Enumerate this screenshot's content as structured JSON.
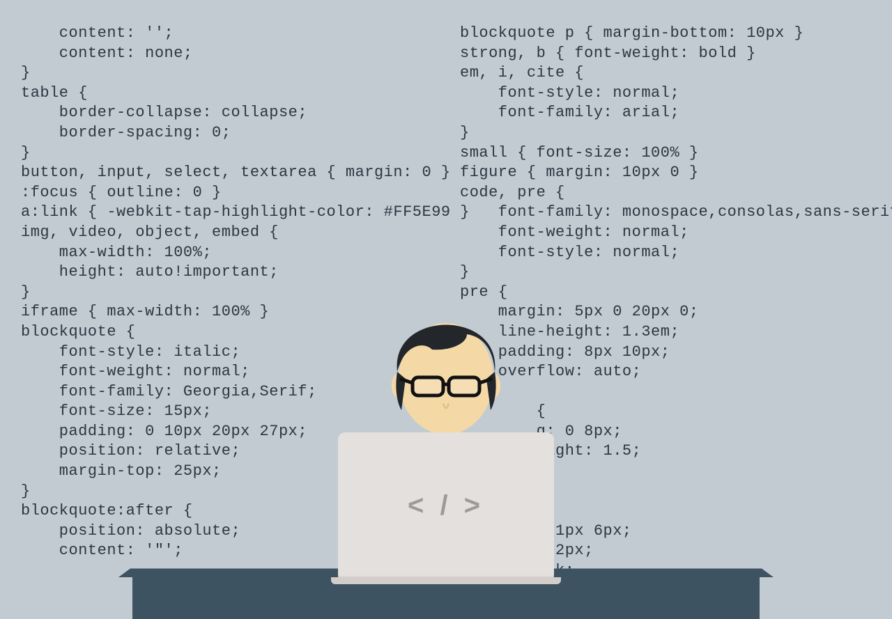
{
  "code_left": [
    "    content: '';",
    "    content: none;",
    "}",
    "table {",
    "    border-collapse: collapse;",
    "    border-spacing: 0;",
    "}",
    "button, input, select, textarea { margin: 0 }",
    ":focus { outline: 0 }",
    "a:link { -webkit-tap-highlight-color: #FF5E99 }",
    "img, video, object, embed {",
    "    max-width: 100%;",
    "    height: auto!important;",
    "}",
    "iframe { max-width: 100% }",
    "blockquote {",
    "    font-style: italic;",
    "    font-weight: normal;",
    "    font-family: Georgia,Serif;",
    "    font-size: 15px;",
    "    padding: 0 10px 20px 27px;",
    "    position: relative;",
    "    margin-top: 25px;",
    "}",
    "blockquote:after {",
    "    position: absolute;",
    "    content: '\"';"
  ],
  "code_right": [
    "blockquote p { margin-bottom: 10px }",
    "strong, b { font-weight: bold }",
    "em, i, cite {",
    "    font-style: normal;",
    "    font-family: arial;",
    "}",
    "small { font-size: 100% }",
    "figure { margin: 10px 0 }",
    "code, pre {",
    "    font-family: monospace,consolas,sans-serif;",
    "    font-weight: normal;",
    "    font-style: normal;",
    "}",
    "pre {",
    "    margin: 5px 0 20px 0;",
    "    line-height: 1.3em;",
    "    padding: 8px 10px;",
    "    overflow: auto;",
    "}",
    "        {",
    "        g: 0 8px;",
    "        eight: 1.5;",
    "",
    "",
    "",
    "        : 1px 6px;",
    "        0 2px;",
    "        ack;"
  ],
  "laptop_symbol": "< / >"
}
